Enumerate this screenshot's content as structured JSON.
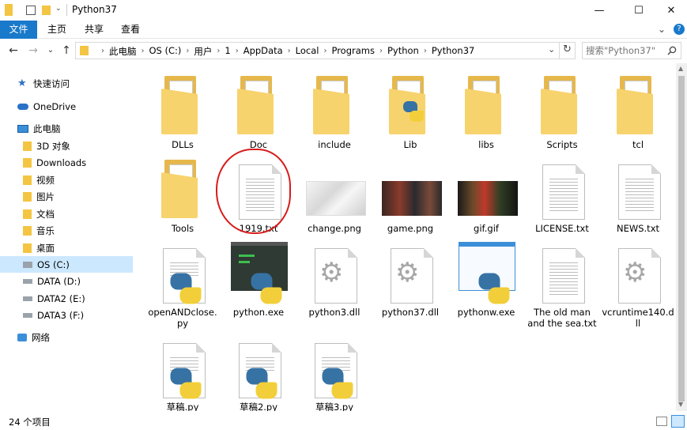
{
  "window": {
    "title": "Python37",
    "minimize": "—",
    "maximize": "☐",
    "close": "✕"
  },
  "ribbon": {
    "tabs": [
      "文件",
      "主页",
      "共享",
      "查看"
    ],
    "help": "?"
  },
  "nav": {
    "back": "←",
    "forward": "→",
    "recent": "⌄",
    "up": "↑",
    "refresh": "↻",
    "dropdown": "⌄"
  },
  "address": {
    "segments": [
      "此电脑",
      "OS (C:)",
      "用户",
      "1",
      "AppData",
      "Local",
      "Programs",
      "Python",
      "Python37"
    ]
  },
  "search": {
    "placeholder": "搜索\"Python37\""
  },
  "sidebar": {
    "items": [
      {
        "label": "快速访问",
        "icon": "star-icon"
      },
      {
        "label": "OneDrive",
        "icon": "cloud-icon"
      },
      {
        "label": "此电脑",
        "icon": "computer-icon"
      },
      {
        "label": "3D 对象",
        "icon": "folder-3d-icon"
      },
      {
        "label": "Downloads",
        "icon": "download-folder-icon"
      },
      {
        "label": "视频",
        "icon": "video-folder-icon"
      },
      {
        "label": "图片",
        "icon": "pictures-folder-icon"
      },
      {
        "label": "文档",
        "icon": "documents-folder-icon"
      },
      {
        "label": "音乐",
        "icon": "music-folder-icon"
      },
      {
        "label": "桌面",
        "icon": "desktop-folder-icon"
      },
      {
        "label": "OS (C:)",
        "icon": "drive-icon"
      },
      {
        "label": "DATA (D:)",
        "icon": "drive-icon"
      },
      {
        "label": "DATA2 (E:)",
        "icon": "drive-icon"
      },
      {
        "label": "DATA3 (F:)",
        "icon": "drive-icon"
      },
      {
        "label": "网络",
        "icon": "network-icon"
      }
    ]
  },
  "files": [
    {
      "name": "DLLs",
      "type": "folder"
    },
    {
      "name": "Doc",
      "type": "folder"
    },
    {
      "name": "include",
      "type": "folder"
    },
    {
      "name": "Lib",
      "type": "folder"
    },
    {
      "name": "libs",
      "type": "folder"
    },
    {
      "name": "Scripts",
      "type": "folder"
    },
    {
      "name": "tcl",
      "type": "folder"
    },
    {
      "name": "Tools",
      "type": "folder"
    },
    {
      "name": "1919.txt",
      "type": "text"
    },
    {
      "name": "change.png",
      "type": "image"
    },
    {
      "name": "game.png",
      "type": "image"
    },
    {
      "name": "gif.gif",
      "type": "image"
    },
    {
      "name": "LICENSE.txt",
      "type": "text"
    },
    {
      "name": "NEWS.txt",
      "type": "text"
    },
    {
      "name": "openANDclose.py",
      "type": "python"
    },
    {
      "name": "python.exe",
      "type": "exe"
    },
    {
      "name": "python3.dll",
      "type": "dll"
    },
    {
      "name": "python37.dll",
      "type": "dll"
    },
    {
      "name": "pythonw.exe",
      "type": "exe"
    },
    {
      "name": "The old man and the sea.txt",
      "type": "text"
    },
    {
      "name": "vcruntime140.dll",
      "type": "dll"
    },
    {
      "name": "草稿.py",
      "type": "python"
    },
    {
      "name": "草稿2.py",
      "type": "python"
    },
    {
      "name": "草稿3.py",
      "type": "python"
    }
  ],
  "status": {
    "count_text": "24 个项目"
  },
  "colors": {
    "accent": "#1979ca",
    "selection": "#cce8ff",
    "annotation": "#d81b1b"
  }
}
